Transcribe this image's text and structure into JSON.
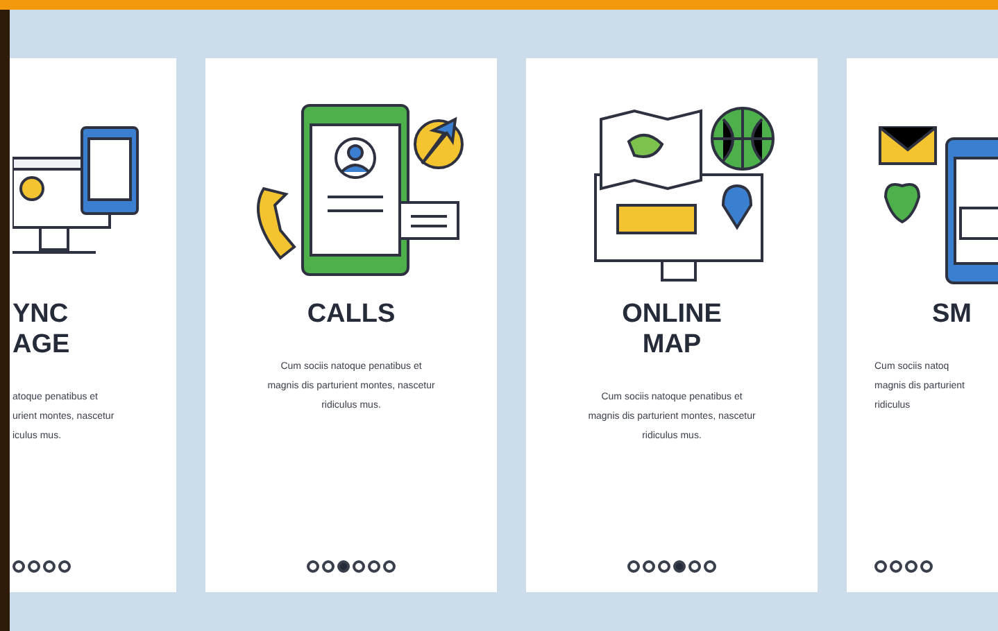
{
  "cards": [
    {
      "title": [
        "YNC",
        "AGE"
      ],
      "text": [
        "atoque penatibus et",
        "urient montes, nascetur",
        "iculus mus."
      ],
      "kind": "sync",
      "dots": [
        {
          "selected": false
        },
        {
          "selected": false
        },
        {
          "selected": false
        },
        {
          "selected": false
        }
      ]
    },
    {
      "title": [
        "CALLS"
      ],
      "text": [
        "Cum sociis natoque penatibus et",
        "magnis dis parturient montes, nascetur",
        "ridiculus mus."
      ],
      "kind": "calls",
      "dots": [
        {
          "selected": false
        },
        {
          "selected": false
        },
        {
          "selected": true
        },
        {
          "selected": false
        },
        {
          "selected": false
        },
        {
          "selected": false
        }
      ]
    },
    {
      "title": [
        "ONLINE",
        "MAP"
      ],
      "text": [
        "Cum sociis natoque penatibus et",
        "magnis dis parturient montes, nascetur",
        "ridiculus mus."
      ],
      "kind": "map",
      "dots": [
        {
          "selected": false
        },
        {
          "selected": false
        },
        {
          "selected": false
        },
        {
          "selected": true
        },
        {
          "selected": false
        },
        {
          "selected": false
        }
      ]
    },
    {
      "title": [
        "SM"
      ],
      "text": [
        "Cum sociis natoq",
        "magnis dis parturient",
        "ridiculus"
      ],
      "kind": "sms",
      "dots": [
        {
          "selected": false
        },
        {
          "selected": false
        },
        {
          "selected": false
        },
        {
          "selected": false
        }
      ]
    }
  ]
}
